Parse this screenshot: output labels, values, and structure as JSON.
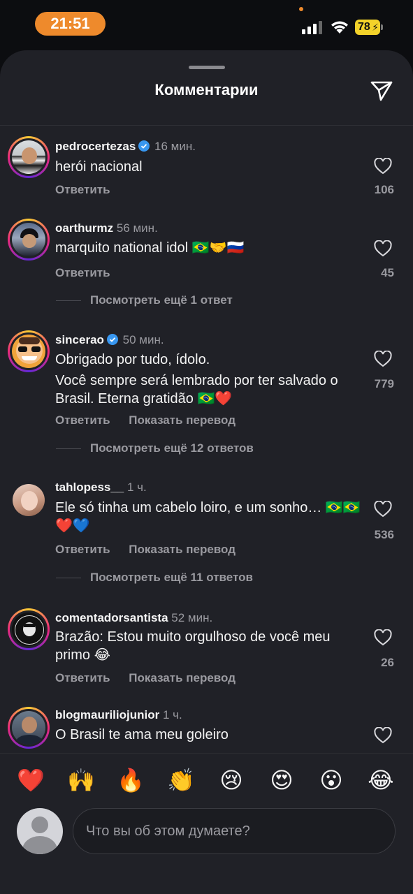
{
  "status_bar": {
    "time": "21:51",
    "battery": "78"
  },
  "sheet": {
    "title": "Комментарии"
  },
  "comments": [
    {
      "user": "pedrocertezas",
      "verified": true,
      "time": "16 мин.",
      "text": [
        "herói nacional"
      ],
      "reply": "Ответить",
      "translate": "",
      "likes": "106",
      "more_replies": ""
    },
    {
      "user": "oarthurmz",
      "verified": false,
      "time": "56 мин.",
      "text": [
        "marquito national idol 🇧🇷🤝🇷🇺"
      ],
      "reply": "Ответить",
      "translate": "",
      "likes": "45",
      "more_replies": "Посмотреть ещё 1 ответ"
    },
    {
      "user": "sincerao",
      "verified": true,
      "time": "50 мин.",
      "text": [
        "Obrigado por tudo, ídolo.",
        "Você sempre será lembrado por ter salvado o Brasil. Eterna gratidão 🇧🇷❤️"
      ],
      "reply": "Ответить",
      "translate": "Показать перевод",
      "likes": "779",
      "more_replies": "Посмотреть ещё 12 ответов"
    },
    {
      "user": "tahlopess__",
      "verified": false,
      "time": "1 ч.",
      "text": [
        "Ele só tinha um cabelo loiro, e um sonho… 🇧🇷🇧🇷❤️💙"
      ],
      "reply": "Ответить",
      "translate": "Показать перевод",
      "likes": "536",
      "more_replies": "Посмотреть ещё 11 ответов"
    },
    {
      "user": "comentadorsantista",
      "verified": false,
      "time": "52 мин.",
      "text": [
        "Brazão: Estou muito orgulhoso de você meu primo 😂"
      ],
      "reply": "Ответить",
      "translate": "Показать перевод",
      "likes": "26",
      "more_replies": ""
    },
    {
      "user": "blogmauriliojunior",
      "verified": false,
      "time": "1 ч.",
      "text": [
        "O Brasil te ama meu goleiro"
      ],
      "reply": "",
      "translate": "",
      "likes": "",
      "more_replies": ""
    }
  ],
  "quick_reactions": [
    "❤️",
    "🙌",
    "🔥",
    "👏",
    "😢",
    "😍",
    "😮",
    "😂"
  ],
  "composer": {
    "placeholder": "Что вы об этом думаете?"
  },
  "colors": {
    "accent_orange": "#ee8a2c",
    "verified_blue": "#3897f0",
    "battery_yellow": "#f3d22a",
    "sheet_bg": "#202127"
  }
}
